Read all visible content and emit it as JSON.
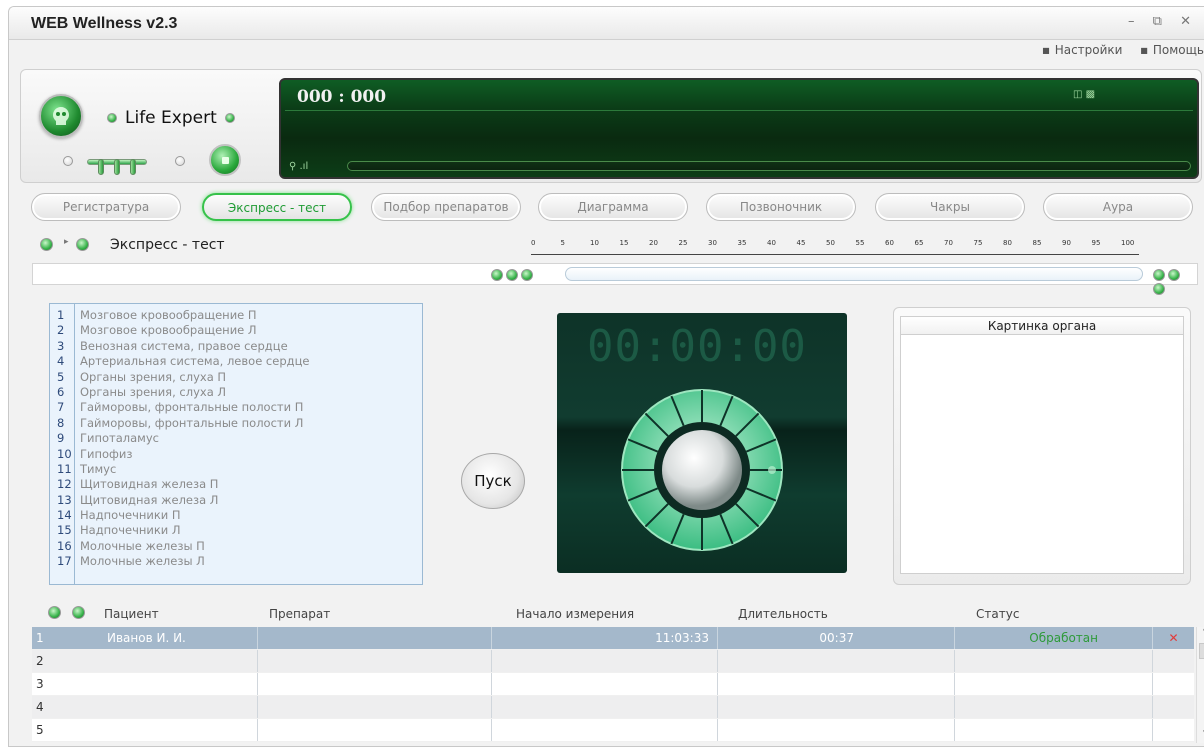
{
  "window": {
    "title": "WEB Wellness  v2.3",
    "controls": [
      "–",
      "⧉",
      "✕"
    ]
  },
  "menu": {
    "settings": "Настройки",
    "help": "Помощь"
  },
  "device": {
    "brand": "Life Expert",
    "counter": "000 : 000"
  },
  "tabs": [
    {
      "label": "Регистратура"
    },
    {
      "label": "Экспресс - тест",
      "active": true
    },
    {
      "label": "Подбор препаратов"
    },
    {
      "label": "Диаграмма"
    },
    {
      "label": "Позвоночник"
    },
    {
      "label": "Чакры"
    },
    {
      "label": "Аура"
    }
  ],
  "section": {
    "title": "Экспресс - тест"
  },
  "ruler": {
    "ticks": [
      "0",
      "5",
      "10",
      "15",
      "20",
      "25",
      "30",
      "35",
      "40",
      "45",
      "50",
      "55",
      "60",
      "65",
      "70",
      "75",
      "80",
      "85",
      "90",
      "95",
      "100"
    ]
  },
  "organs": [
    {
      "n": "1",
      "name": "Мозговое кровообращение П"
    },
    {
      "n": "2",
      "name": "Мозговое кровообращение Л"
    },
    {
      "n": "3",
      "name": "Венозная система, правое сердце"
    },
    {
      "n": "4",
      "name": "Артериальная система, левое сердце"
    },
    {
      "n": "5",
      "name": "Органы зрения, слуха П"
    },
    {
      "n": "6",
      "name": "Органы зрения, слуха Л"
    },
    {
      "n": "7",
      "name": "Гайморовы, фронтальные полости П"
    },
    {
      "n": "8",
      "name": "Гайморовы, фронтальные полости Л"
    },
    {
      "n": "9",
      "name": "Гипоталамус"
    },
    {
      "n": "10",
      "name": "Гипофиз"
    },
    {
      "n": "11",
      "name": "Тимус"
    },
    {
      "n": "12",
      "name": "Щитовидная железа П"
    },
    {
      "n": "13",
      "name": "Щитовидная железа Л"
    },
    {
      "n": "14",
      "name": "Надпочечники П"
    },
    {
      "n": "15",
      "name": "Надпочечники Л"
    },
    {
      "n": "16",
      "name": "Молочные железы П"
    },
    {
      "n": "17",
      "name": "Молочные железы Л"
    }
  ],
  "start_button": "Пуск",
  "timer": "00:00:00",
  "organ_picture": {
    "title": "Картинка органа"
  },
  "table": {
    "headers": {
      "patient": "Пациент",
      "drug": "Препарат",
      "start": "Начало измерения",
      "duration": "Длительность",
      "status": "Статус"
    },
    "rows": [
      {
        "n": "1",
        "patient": "Иванов И. И.",
        "drug": "",
        "start": "11:03:33",
        "duration": "00:37",
        "status": "Обработан",
        "delete": "✕"
      },
      {
        "n": "2",
        "patient": "",
        "drug": "",
        "start": "",
        "duration": "",
        "status": "",
        "delete": ""
      },
      {
        "n": "3",
        "patient": "",
        "drug": "",
        "start": "",
        "duration": "",
        "status": "",
        "delete": ""
      },
      {
        "n": "4",
        "patient": "",
        "drug": "",
        "start": "",
        "duration": "",
        "status": "",
        "delete": ""
      },
      {
        "n": "5",
        "patient": "",
        "drug": "",
        "start": "",
        "duration": "",
        "status": "",
        "delete": ""
      }
    ]
  },
  "colors": {
    "accent_green": "#36c24a",
    "status_ok": "#2e9a3a",
    "delete_red": "#e23a3a",
    "selected_row": "#a4b8cb"
  }
}
